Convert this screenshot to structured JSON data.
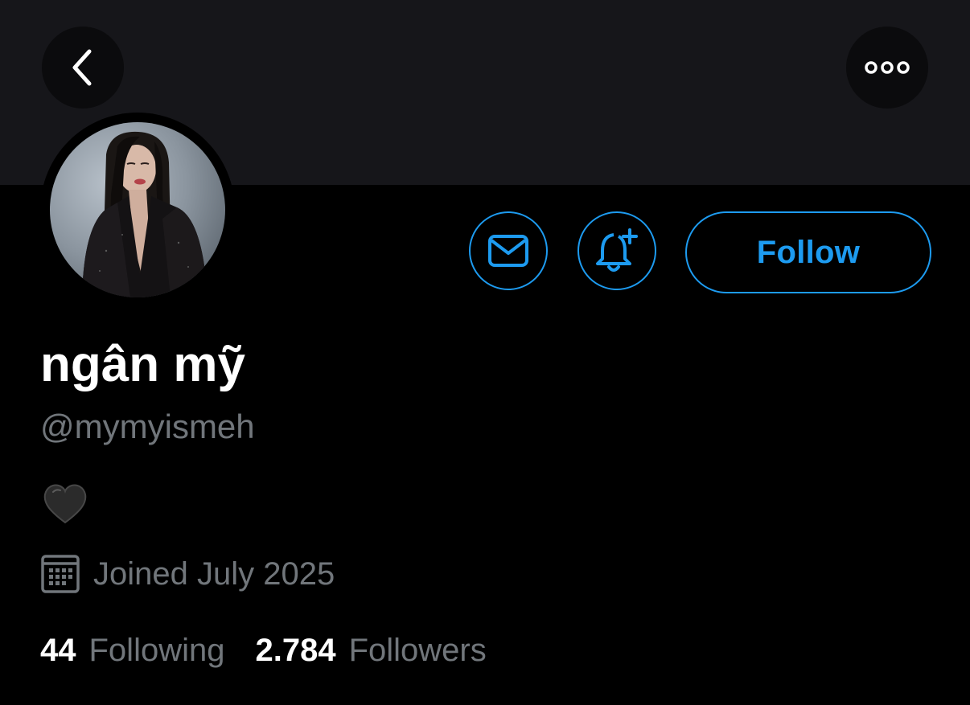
{
  "profile": {
    "display_name": "ngân mỹ",
    "handle": "@mymyismeh",
    "bio_emoji": "🖤",
    "joined": "Joined July 2025",
    "following_count": "44",
    "following_label": "Following",
    "followers_count": "2.784",
    "followers_label": "Followers"
  },
  "actions": {
    "follow_label": "Follow"
  },
  "icons": {
    "back": "chevron-left-icon",
    "more": "ellipsis-icon",
    "message": "envelope-icon",
    "notify": "bell-plus-icon",
    "calendar": "calendar-icon"
  },
  "colors": {
    "accent": "#1d9bf0",
    "background": "#000000",
    "banner": "#16161a",
    "secondary_text": "#71767b",
    "primary_text": "#ffffff"
  }
}
